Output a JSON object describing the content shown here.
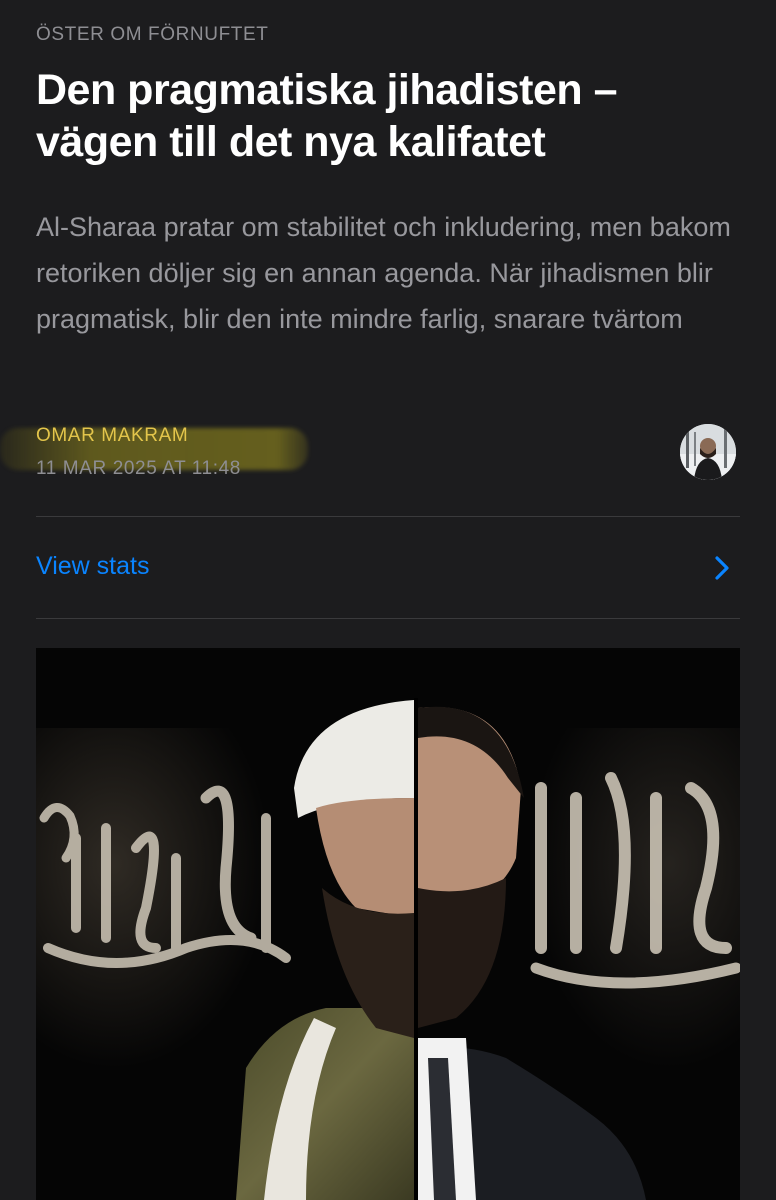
{
  "article": {
    "publication": "ÖSTER OM FÖRNUFTET",
    "title": "Den pragmatiska jihadisten – vägen till det nya kalifatet",
    "subtitle": "Al-Sharaa pratar om stabilitet och inkludering, men bakom retoriken döljer sig en annan agenda. När jihadismen blir pragmatisk, blir den inte mindre farlig, snarare tvärtom",
    "author": "OMAR MAKRAM",
    "date": "11 MAR 2025 AT 11:48"
  },
  "stats": {
    "label": "View stats"
  },
  "icons": {
    "chevron": "chevron-right-icon",
    "avatar": "author-avatar"
  },
  "colors": {
    "background": "#1c1c1e",
    "accent_link": "#0a84ff",
    "author": "#e3c54b",
    "muted": "#8e8e93"
  }
}
